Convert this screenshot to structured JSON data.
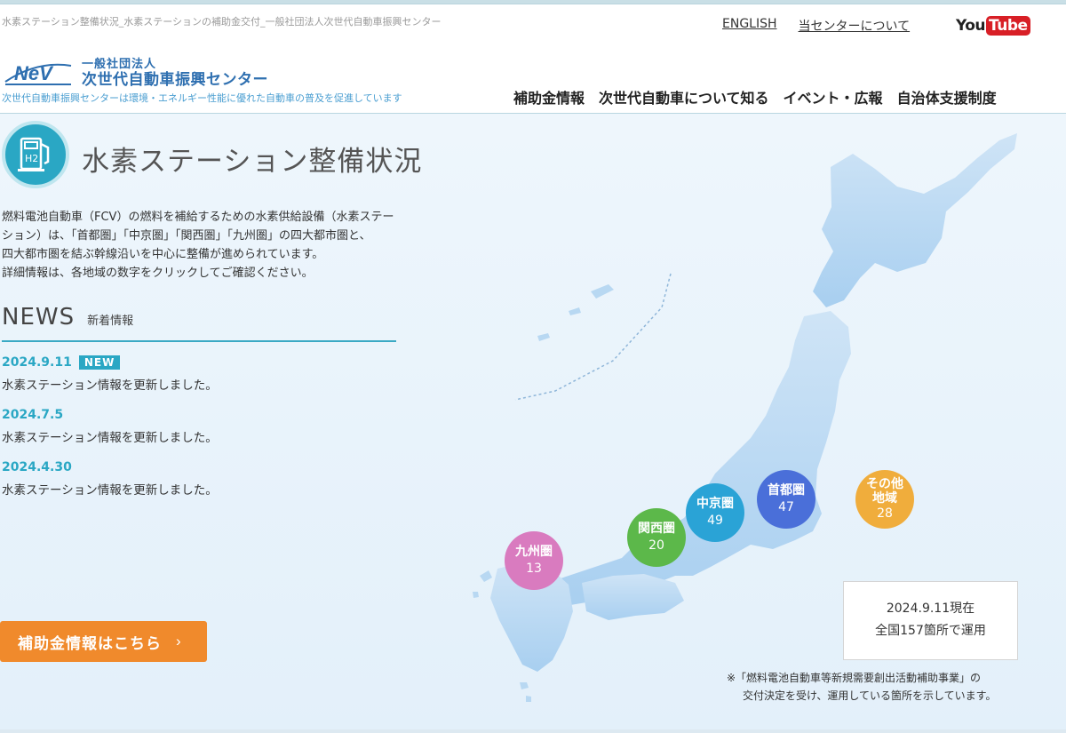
{
  "page_desc": "水素ステーション整備状況_水素ステーションの補助金交付_一般社団法人次世代自動車振興センター",
  "util_nav": {
    "english": "ENGLISH",
    "about": "当センターについて"
  },
  "youtube": {
    "you": "You",
    "tube": "Tube"
  },
  "logo": {
    "mark": "NeV",
    "line1": "一般社団法人",
    "line2": "次世代自動車振興センター"
  },
  "tagline": "次世代自動車振興センターは環境・エネルギー性能に優れた自動車の普及を促進しています",
  "main_nav": [
    "補助金情報",
    "次世代自動車について知る",
    "イベント・広報",
    "自治体支援制度"
  ],
  "title": "水素ステーション整備状況",
  "title_icon_text": "H2",
  "intro": [
    "燃料電池自動車（FCV）の燃料を補給するための水素供給設備（水素ステー",
    "ション）は、「首都圏」「中京圏」「関西圏」「九州圏」の四大都市圏と、",
    "四大都市圏を結ぶ幹線沿いを中心に整備が進められています。",
    "詳細情報は、各地域の数字をクリックしてご確認ください。"
  ],
  "news": {
    "heading_en": "NEWS",
    "heading_ja": "新着情報",
    "badge": "NEW",
    "items": [
      {
        "date": "2024.9.11",
        "text": "水素ステーション情報を更新しました。"
      },
      {
        "date": "2024.7.5",
        "text": "水素ステーション情報を更新しました。"
      },
      {
        "date": "2024.4.30",
        "text": "水素ステーション情報を更新しました。"
      }
    ]
  },
  "subsidy_button": "補助金情報はこちら",
  "regions": [
    {
      "key": "kyushu",
      "name": "九州圏",
      "count": "13",
      "color": "#d97bbf"
    },
    {
      "key": "kansai",
      "name": "関西圏",
      "count": "20",
      "color": "#5cb84a"
    },
    {
      "key": "chukyo",
      "name": "中京圏",
      "count": "49",
      "color": "#2aa3d6"
    },
    {
      "key": "shutoken",
      "name": "首都圏",
      "count": "47",
      "color": "#4a6fd9"
    },
    {
      "key": "other",
      "name": "その他地域",
      "name_line1": "その他",
      "name_line2": "地域",
      "count": "28",
      "color": "#f0ad3c"
    }
  ],
  "info_box": {
    "line1": "2024.9.11現在",
    "line2": "全国157箇所で運用"
  },
  "footnote": {
    "line1": "※「燃料電池自動車等新規需要創出活動補助事業」の",
    "line2": "交付決定を受け、運用している箇所を示しています。"
  }
}
